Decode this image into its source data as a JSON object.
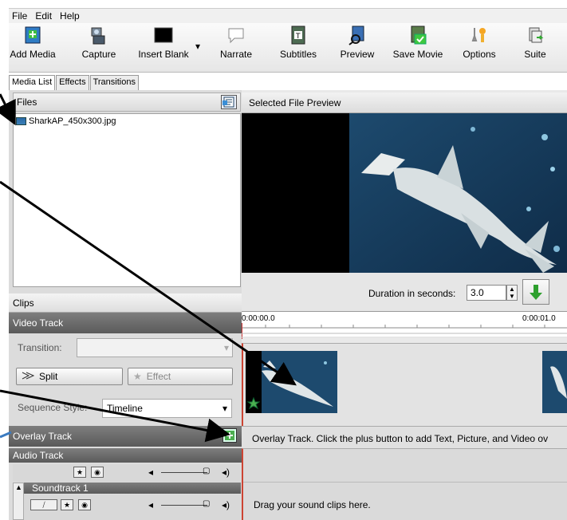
{
  "menu": [
    "File",
    "Edit",
    "Help"
  ],
  "toolbar": [
    {
      "label": "Add Media",
      "icon": "add-media-icon"
    },
    {
      "label": "Capture",
      "icon": "camera-icon"
    },
    {
      "label": "Insert Blank",
      "icon": "blank-icon"
    },
    {
      "label": "Narrate",
      "icon": "speech-bubble-icon"
    },
    {
      "label": "Subtitles",
      "icon": "subtitles-icon"
    },
    {
      "label": "Preview",
      "icon": "preview-icon"
    },
    {
      "label": "Save Movie",
      "icon": "save-movie-icon"
    },
    {
      "label": "Options",
      "icon": "options-icon"
    },
    {
      "label": "Suite",
      "icon": "suite-icon"
    }
  ],
  "tabs": [
    "Media List",
    "Effects",
    "Transitions"
  ],
  "files": {
    "title": "Files",
    "items": [
      "SharkAP_450x300.jpg"
    ]
  },
  "preview": {
    "title": "Selected File Preview",
    "duration_label": "Duration in seconds:",
    "duration_value": "3.0"
  },
  "clips": {
    "title": "Clips",
    "video_track": "Video Track",
    "transition_label": "Transition:",
    "split_label": "Split",
    "effect_label": "Effect",
    "sequence_label": "Sequence Style:",
    "sequence_value": "Timeline",
    "overlay_track": "Overlay Track",
    "audio_track": "Audio Track",
    "soundtrack": "Soundtrack 1"
  },
  "timeline": {
    "start": "0:00:00.0",
    "end": "0:00:01.0",
    "overlay_hint": "Overlay Track. Click the plus button to add Text, Picture, and Video ov",
    "audio_hint": "Drag your sound clips here."
  },
  "colors": {
    "track_bar": "#6b6b6b",
    "accent_green": "#3aa83a",
    "timeline_marker": "#cc3333"
  }
}
